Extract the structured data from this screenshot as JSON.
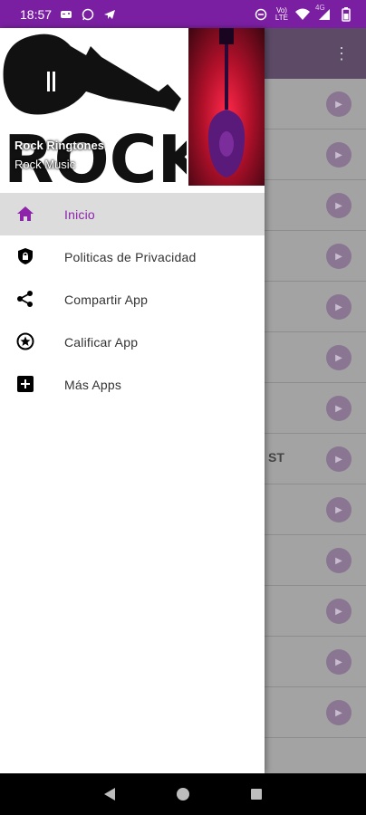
{
  "status_bar": {
    "time": "18:57",
    "network_label_top": "Vo)",
    "network_label_bottom": "LTE",
    "signal_label": "4G"
  },
  "drawer": {
    "header": {
      "title": "Rock Ringtones",
      "subtitle": "Rock Music",
      "art_text": "ROCK"
    },
    "menu": [
      {
        "label": "Inicio",
        "icon": "home-icon",
        "active": true
      },
      {
        "label": "Politicas de Privacidad",
        "icon": "shield-lock-icon",
        "active": false
      },
      {
        "label": "Compartir App",
        "icon": "share-icon",
        "active": false
      },
      {
        "label": "Calificar App",
        "icon": "star-badge-icon",
        "active": false
      },
      {
        "label": "Más Apps",
        "icon": "add-box-icon",
        "active": false
      }
    ]
  },
  "background": {
    "visible_fragment": "ST"
  },
  "colors": {
    "accent": "#8e24aa",
    "status_bar": "#7b1fa2"
  }
}
